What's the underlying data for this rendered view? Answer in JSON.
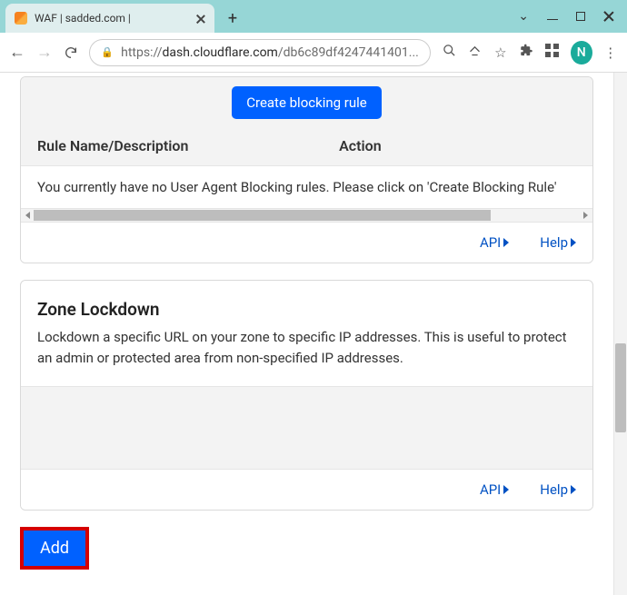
{
  "browser": {
    "tab_title": "WAF | sadded.com |",
    "url_prefix": "https://",
    "url_host": "dash.cloudflare.com",
    "url_path": "/db6c89df4247441401...",
    "avatar_letter": "N"
  },
  "ua_block": {
    "create_button": "Create blocking rule",
    "col_name": "Rule Name/Description",
    "col_action": "Action",
    "empty_message": "You currently have no User Agent Blocking rules. Please click on 'Create Blocking Rule'",
    "api_link": "API",
    "help_link": "Help"
  },
  "zone": {
    "title": "Zone Lockdown",
    "description": "Lockdown a specific URL on your zone to specific IP addresses. This is useful to protect an admin or protected area from non-specified IP addresses.",
    "api_link": "API",
    "help_link": "Help"
  },
  "add_button": "Add"
}
